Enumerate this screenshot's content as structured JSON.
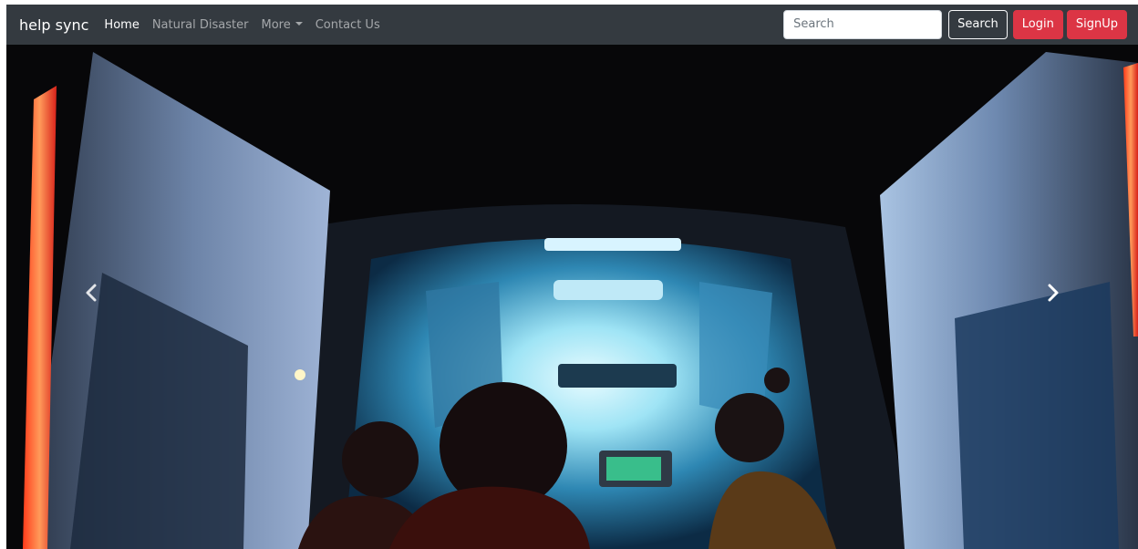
{
  "navbar": {
    "brand": "help sync",
    "links": [
      {
        "label": "Home",
        "active": true
      },
      {
        "label": "Natural Disaster",
        "active": false
      },
      {
        "label": "More",
        "active": false,
        "dropdown": true
      },
      {
        "label": "Contact Us",
        "active": false
      }
    ],
    "search": {
      "placeholder": "Search",
      "value": ""
    },
    "search_button": "Search",
    "login_button": "Login",
    "signup_button": "SignUp"
  },
  "carousel": {
    "slide_image": "ambulance-interior-photo",
    "prev_icon": "chevron-left-icon",
    "next_icon": "chevron-right-icon"
  },
  "colors": {
    "navbar_bg": "#343a40",
    "danger": "#dc3545",
    "nav_active": "#ffffff",
    "nav_muted": "rgba(255,255,255,0.55)"
  }
}
